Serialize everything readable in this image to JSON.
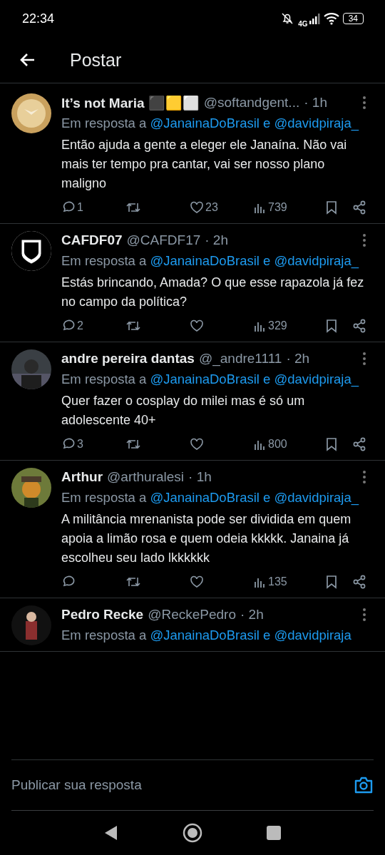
{
  "status_bar": {
    "time": "22:34",
    "network": "4G",
    "battery": "34"
  },
  "header": {
    "title": "Postar"
  },
  "replies": [
    {
      "name": "It’s not Maria ⬛🟨⬜",
      "handle": "@softandgent...",
      "time": "· 1h",
      "reply_prefix": "Em resposta a",
      "mentions": [
        "@JanainaDoBrasil",
        "@davidpiraja_"
      ],
      "joiner": "e",
      "text": "Então ajuda a gente a eleger ele Janaína. Não vai mais ter tempo pra cantar, vai ser nosso plano maligno",
      "stats": {
        "replies": "1",
        "likes": "23",
        "views": "739"
      }
    },
    {
      "name": "CAFDF07",
      "handle": "@CAFDF17",
      "time": "· 2h",
      "reply_prefix": "Em resposta a",
      "mentions": [
        "@JanainaDoBrasil",
        "@davidpiraja_"
      ],
      "joiner": "e",
      "text": "Estás brincando, Amada? O que esse rapazola já fez no campo da política?",
      "stats": {
        "replies": "2",
        "views": "329"
      }
    },
    {
      "name": "andre pereira dantas",
      "handle": "@_andre1111",
      "time": "· 2h",
      "reply_prefix": "Em resposta a",
      "mentions": [
        "@JanainaDoBrasil",
        "@davidpiraja_"
      ],
      "joiner": "e",
      "text": "Quer fazer o cosplay do milei mas é só um adolescente 40+",
      "stats": {
        "replies": "3",
        "views": "800"
      }
    },
    {
      "name": "Arthur",
      "handle": "@arthuralesi",
      "time": "· 1h",
      "reply_prefix": "Em resposta a",
      "mentions": [
        "@JanainaDoBrasil",
        "@davidpiraja_"
      ],
      "joiner": "e",
      "text": "A militância mrenanista pode ser dividida em quem apoia a limão rosa e quem odeia kkkkk. Janaina já escolheu seu lado lkkkkkk",
      "stats": {
        "views": "135"
      }
    },
    {
      "name": "Pedro Recke",
      "handle": "@ReckePedro",
      "time": "· 2h",
      "reply_prefix": "Em resposta a",
      "mentions": [
        "@JanainaDoBrasil",
        "@davidpiraja"
      ],
      "joiner": "e"
    }
  ],
  "composer": {
    "placeholder": "Publicar sua resposta"
  }
}
